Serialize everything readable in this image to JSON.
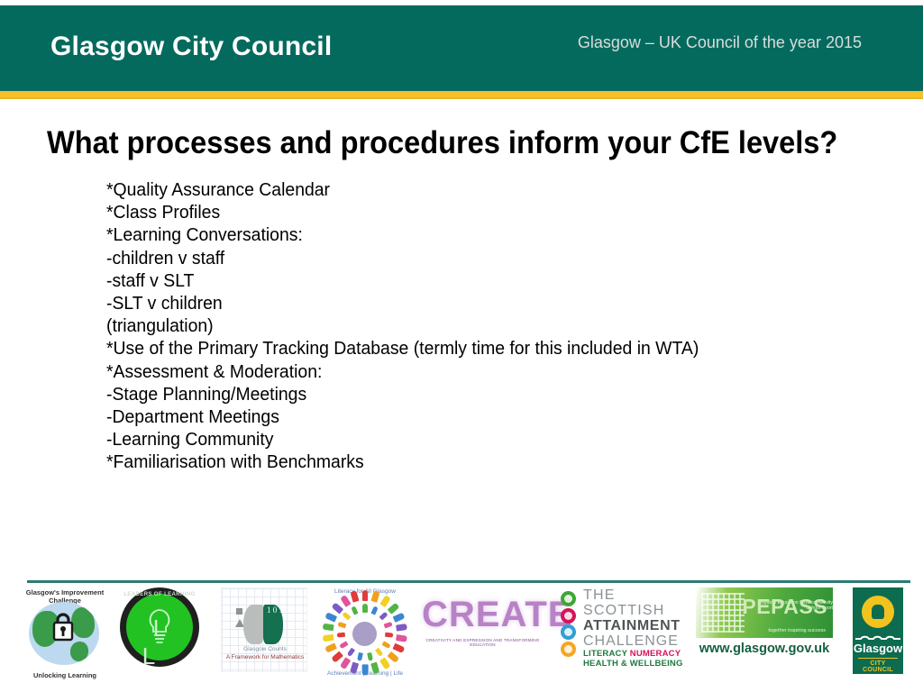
{
  "header": {
    "brand_title": "Glasgow City Council",
    "tagline": "Glasgow – UK Council of the year 2015",
    "band_color": "#046A5E",
    "accent_color": "#F7BF28"
  },
  "slide": {
    "title": "What processes and procedures inform your CfE levels?",
    "body_lines": [
      "*Quality Assurance Calendar",
      "*Class Profiles",
      "*Learning Conversations:",
      "-children v staff",
      "-staff v SLT",
      "-SLT v children",
      "(triangulation)",
      "*Use of the Primary Tracking Database (termly time for this included in WTA)",
      "*Assessment & Moderation:",
      "-Stage Planning/Meetings",
      "-Department Meetings",
      "-Learning Community",
      "*Familiarisation with Benchmarks"
    ]
  },
  "footer": {
    "divider_color": "#2A7B72",
    "logos": {
      "globe": {
        "name": "glasgows-improvement-challenge-logo",
        "arc_top": "Glasgow's Improvement Challenge",
        "arc_bottom": "Unlocking Learning"
      },
      "leaders_of_learning": {
        "name": "leaders-of-learning-logo",
        "arc_text": "LEADERS OF LEARNING",
        "letters": "L L"
      },
      "glasgow_counts": {
        "name": "glasgow-counts-logo",
        "caption_line1": "Glasgow Counts",
        "caption_line2": "A Framework for Mathematics",
        "digits": "1 0 1 0 1 1"
      },
      "literacy_for_all": {
        "name": "literacy-for-all-glasgow-logo",
        "arc_top": "Literacy for All Glasgow",
        "arc_bottom": "Achievement | Learning | Life"
      },
      "create": {
        "name": "create-logo",
        "word": "CREATE",
        "subtitle": "CREATIVITY AND EXPRESSION AND TRANSFORMING EDUCATION"
      },
      "scottish_attainment_challenge": {
        "name": "scottish-attainment-challenge-logo",
        "line1": "THE SCOTTISH",
        "line2": "ATTAINMENT",
        "line3": "CHALLENGE",
        "line4_literacy": "LITERACY",
        "line4_numeracy": "NUMERACY",
        "line5": "HEALTH & WELLBEING"
      },
      "pepass": {
        "name": "pepass-logo",
        "words": "Physical Education\nPhysical Activity\nSchool Sport",
        "brand": "PEPASS",
        "tagline": "together inspiring success",
        "url": "www.glasgow.gov.uk"
      },
      "crest": {
        "name": "glasgow-city-council-crest",
        "city": "Glasgow",
        "council": "CITY COUNCIL"
      }
    }
  }
}
